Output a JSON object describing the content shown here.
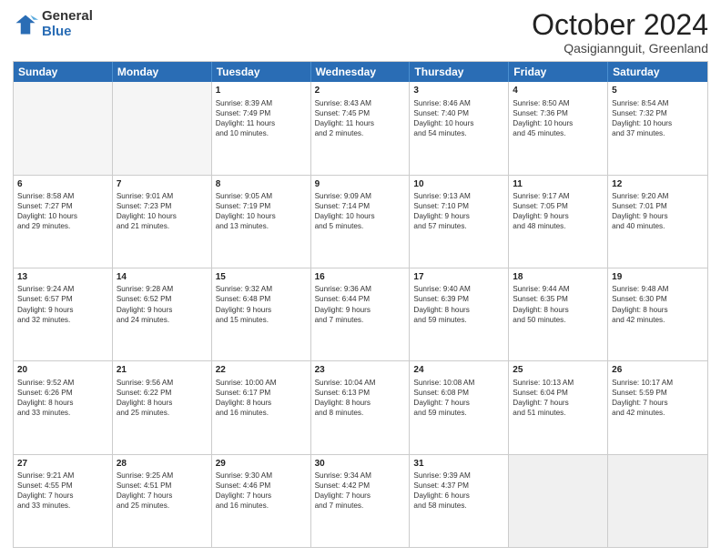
{
  "logo": {
    "general": "General",
    "blue": "Blue"
  },
  "title": "October 2024",
  "location": "Qasigiannguit, Greenland",
  "header_days": [
    "Sunday",
    "Monday",
    "Tuesday",
    "Wednesday",
    "Thursday",
    "Friday",
    "Saturday"
  ],
  "rows": [
    [
      {
        "day": "",
        "text": "",
        "empty": true
      },
      {
        "day": "",
        "text": "",
        "empty": true
      },
      {
        "day": "1",
        "text": "Sunrise: 8:39 AM\nSunset: 7:49 PM\nDaylight: 11 hours\nand 10 minutes."
      },
      {
        "day": "2",
        "text": "Sunrise: 8:43 AM\nSunset: 7:45 PM\nDaylight: 11 hours\nand 2 minutes."
      },
      {
        "day": "3",
        "text": "Sunrise: 8:46 AM\nSunset: 7:40 PM\nDaylight: 10 hours\nand 54 minutes."
      },
      {
        "day": "4",
        "text": "Sunrise: 8:50 AM\nSunset: 7:36 PM\nDaylight: 10 hours\nand 45 minutes."
      },
      {
        "day": "5",
        "text": "Sunrise: 8:54 AM\nSunset: 7:32 PM\nDaylight: 10 hours\nand 37 minutes."
      }
    ],
    [
      {
        "day": "6",
        "text": "Sunrise: 8:58 AM\nSunset: 7:27 PM\nDaylight: 10 hours\nand 29 minutes."
      },
      {
        "day": "7",
        "text": "Sunrise: 9:01 AM\nSunset: 7:23 PM\nDaylight: 10 hours\nand 21 minutes."
      },
      {
        "day": "8",
        "text": "Sunrise: 9:05 AM\nSunset: 7:19 PM\nDaylight: 10 hours\nand 13 minutes."
      },
      {
        "day": "9",
        "text": "Sunrise: 9:09 AM\nSunset: 7:14 PM\nDaylight: 10 hours\nand 5 minutes."
      },
      {
        "day": "10",
        "text": "Sunrise: 9:13 AM\nSunset: 7:10 PM\nDaylight: 9 hours\nand 57 minutes."
      },
      {
        "day": "11",
        "text": "Sunrise: 9:17 AM\nSunset: 7:05 PM\nDaylight: 9 hours\nand 48 minutes."
      },
      {
        "day": "12",
        "text": "Sunrise: 9:20 AM\nSunset: 7:01 PM\nDaylight: 9 hours\nand 40 minutes."
      }
    ],
    [
      {
        "day": "13",
        "text": "Sunrise: 9:24 AM\nSunset: 6:57 PM\nDaylight: 9 hours\nand 32 minutes."
      },
      {
        "day": "14",
        "text": "Sunrise: 9:28 AM\nSunset: 6:52 PM\nDaylight: 9 hours\nand 24 minutes."
      },
      {
        "day": "15",
        "text": "Sunrise: 9:32 AM\nSunset: 6:48 PM\nDaylight: 9 hours\nand 15 minutes."
      },
      {
        "day": "16",
        "text": "Sunrise: 9:36 AM\nSunset: 6:44 PM\nDaylight: 9 hours\nand 7 minutes."
      },
      {
        "day": "17",
        "text": "Sunrise: 9:40 AM\nSunset: 6:39 PM\nDaylight: 8 hours\nand 59 minutes."
      },
      {
        "day": "18",
        "text": "Sunrise: 9:44 AM\nSunset: 6:35 PM\nDaylight: 8 hours\nand 50 minutes."
      },
      {
        "day": "19",
        "text": "Sunrise: 9:48 AM\nSunset: 6:30 PM\nDaylight: 8 hours\nand 42 minutes."
      }
    ],
    [
      {
        "day": "20",
        "text": "Sunrise: 9:52 AM\nSunset: 6:26 PM\nDaylight: 8 hours\nand 33 minutes."
      },
      {
        "day": "21",
        "text": "Sunrise: 9:56 AM\nSunset: 6:22 PM\nDaylight: 8 hours\nand 25 minutes."
      },
      {
        "day": "22",
        "text": "Sunrise: 10:00 AM\nSunset: 6:17 PM\nDaylight: 8 hours\nand 16 minutes."
      },
      {
        "day": "23",
        "text": "Sunrise: 10:04 AM\nSunset: 6:13 PM\nDaylight: 8 hours\nand 8 minutes."
      },
      {
        "day": "24",
        "text": "Sunrise: 10:08 AM\nSunset: 6:08 PM\nDaylight: 7 hours\nand 59 minutes."
      },
      {
        "day": "25",
        "text": "Sunrise: 10:13 AM\nSunset: 6:04 PM\nDaylight: 7 hours\nand 51 minutes."
      },
      {
        "day": "26",
        "text": "Sunrise: 10:17 AM\nSunset: 5:59 PM\nDaylight: 7 hours\nand 42 minutes."
      }
    ],
    [
      {
        "day": "27",
        "text": "Sunrise: 9:21 AM\nSunset: 4:55 PM\nDaylight: 7 hours\nand 33 minutes."
      },
      {
        "day": "28",
        "text": "Sunrise: 9:25 AM\nSunset: 4:51 PM\nDaylight: 7 hours\nand 25 minutes."
      },
      {
        "day": "29",
        "text": "Sunrise: 9:30 AM\nSunset: 4:46 PM\nDaylight: 7 hours\nand 16 minutes."
      },
      {
        "day": "30",
        "text": "Sunrise: 9:34 AM\nSunset: 4:42 PM\nDaylight: 7 hours\nand 7 minutes."
      },
      {
        "day": "31",
        "text": "Sunrise: 9:39 AM\nSunset: 4:37 PM\nDaylight: 6 hours\nand 58 minutes."
      },
      {
        "day": "",
        "text": "",
        "empty": true,
        "shaded": true
      },
      {
        "day": "",
        "text": "",
        "empty": true,
        "shaded": true
      }
    ]
  ]
}
